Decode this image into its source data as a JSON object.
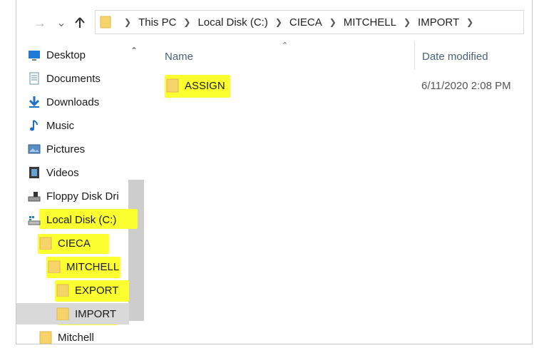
{
  "toolbar": {
    "back_icon": "back-arrow-icon",
    "recent_icon": "chevron-down-icon",
    "up_icon": "up-arrow-icon"
  },
  "breadcrumb": [
    "This PC",
    "Local Disk (C:)",
    "CIECA",
    "MITCHELL",
    "IMPORT"
  ],
  "nav": {
    "items": [
      {
        "label": "Desktop",
        "icon": "desktop-icon"
      },
      {
        "label": "Documents",
        "icon": "documents-icon"
      },
      {
        "label": "Downloads",
        "icon": "downloads-icon"
      },
      {
        "label": "Music",
        "icon": "music-icon"
      },
      {
        "label": "Pictures",
        "icon": "pictures-icon"
      },
      {
        "label": "Videos",
        "icon": "videos-icon"
      },
      {
        "label": "Floppy Disk Dri",
        "icon": "floppy-drive-icon"
      },
      {
        "label": "Local Disk (C:)",
        "icon": "local-disk-icon"
      },
      {
        "label": "CIECA",
        "icon": "folder-icon"
      },
      {
        "label": "MITCHELL",
        "icon": "folder-icon"
      },
      {
        "label": "EXPORT",
        "icon": "folder-icon"
      },
      {
        "label": "IMPORT",
        "icon": "folder-icon"
      },
      {
        "label": "Mitchell",
        "icon": "folder-icon"
      }
    ]
  },
  "columns": {
    "name": "Name",
    "date": "Date modified"
  },
  "files": [
    {
      "name": "ASSIGN",
      "date": "6/11/2020 2:08 PM"
    }
  ],
  "colors": {
    "highlight": "#fbff2f",
    "folder": "#f6d46a",
    "header_text": "#4c607a",
    "selected_bg": "#d9d9d9"
  }
}
